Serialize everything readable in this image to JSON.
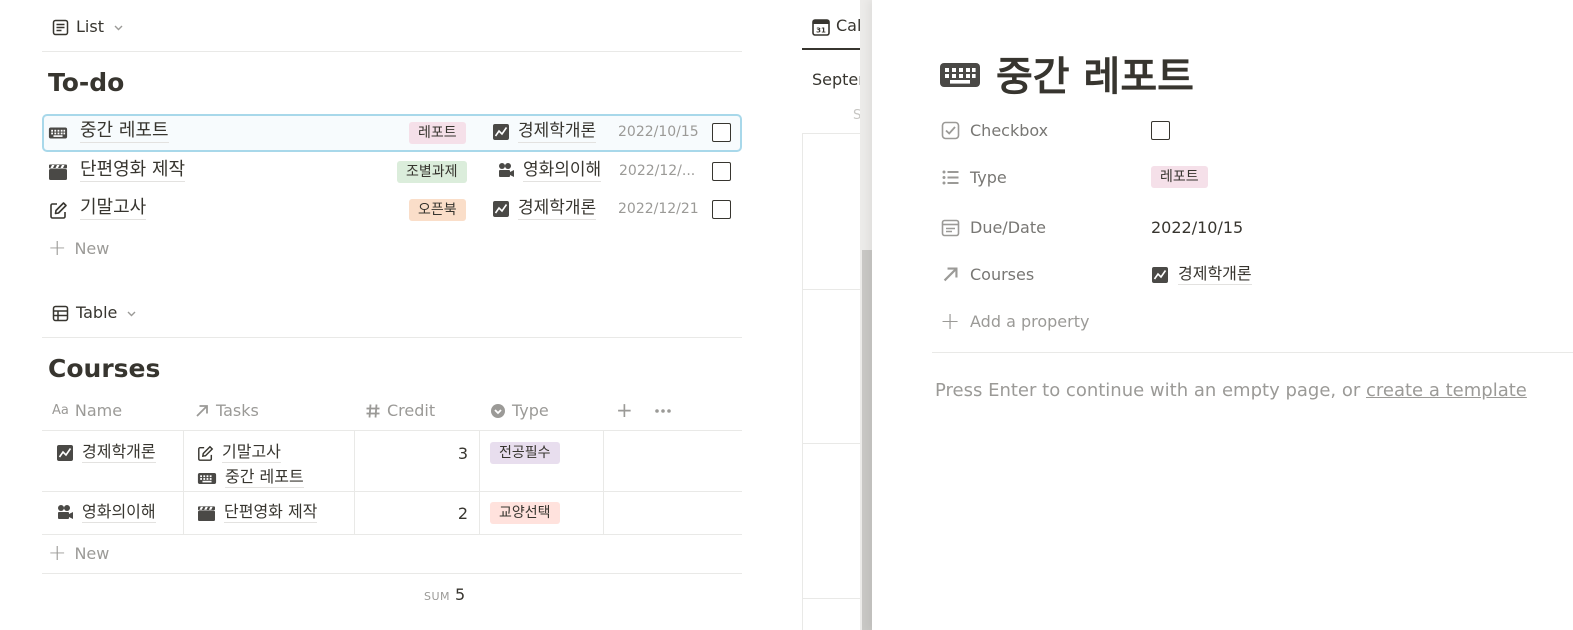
{
  "list_view": {
    "switch_label": "List",
    "title": "To-do",
    "items": [
      {
        "title": "중간 레포트",
        "icon": "keyboard-icon",
        "tag": "레포트",
        "course": "경제학개론",
        "course_icon": "chart-icon",
        "date": "2022/10/15"
      },
      {
        "title": "단편영화 제작",
        "icon": "clapperboard-icon",
        "tag": "조별과제",
        "course": "영화의이해",
        "course_icon": "film-camera-icon",
        "date": "2022/12/..."
      },
      {
        "title": "기말고사",
        "icon": "pencil-square-icon",
        "tag": "오픈북",
        "course": "경제학개론",
        "course_icon": "chart-icon",
        "date": "2022/12/21"
      }
    ],
    "new_label": "New"
  },
  "table_view": {
    "switch_label": "Table",
    "title": "Courses",
    "columns": [
      "Name",
      "Tasks",
      "Credit",
      "Type"
    ],
    "rows": [
      {
        "name": "경제학개론",
        "tasks": [
          "기말고사",
          "중간 레포트"
        ],
        "credit": "3",
        "type": "전공필수"
      },
      {
        "name": "영화의이해",
        "tasks": [
          "단편영화 제작"
        ],
        "credit": "2",
        "type": "교양선택"
      }
    ],
    "new_label": "New",
    "sum_label": "SUM",
    "sum_value": "5"
  },
  "calendar_view": {
    "tab_label": "Cal",
    "month_label": "Septer",
    "weekday_fragment": "S"
  },
  "page": {
    "title": "중간 레포트",
    "properties": {
      "checkbox_label": "Checkbox",
      "type_label": "Type",
      "type_value": "레포트",
      "due_label": "Due/Date",
      "due_value": "2022/10/15",
      "courses_label": "Courses",
      "courses_value": "경제학개론"
    },
    "add_property": "Add a property",
    "hint_text": "Press Enter to continue with an empty page, or ",
    "hint_link": "create a template"
  },
  "colors": {
    "tag_report": "#f5e0e9",
    "tag_group": "#dbeddb",
    "tag_openbook": "#fadec9",
    "tag_major": "#e8deee",
    "tag_liberal": "#ffe2dd",
    "selection": "#a8d8ea"
  }
}
